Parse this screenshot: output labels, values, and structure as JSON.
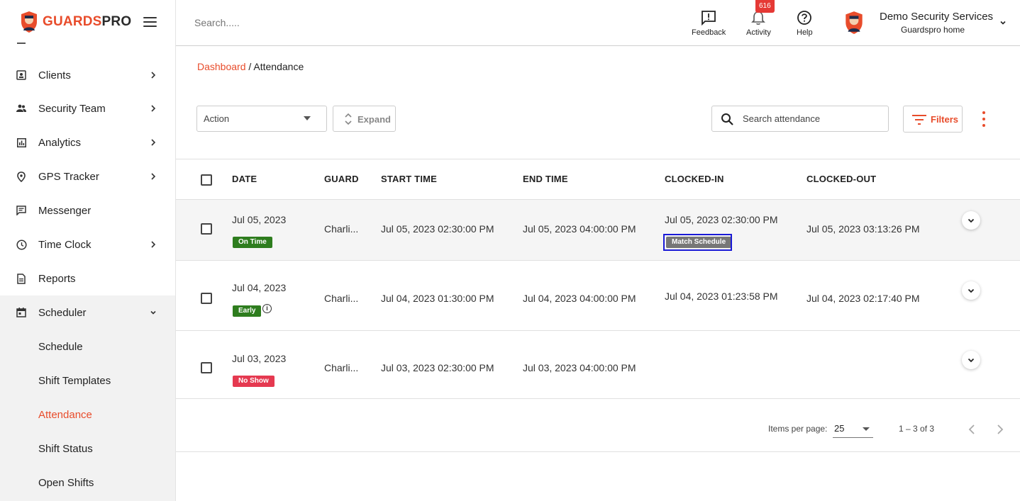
{
  "brand": {
    "part1": "GUARDS",
    "part2": "PRO"
  },
  "sidebar": {
    "items": [
      {
        "label": "Clients",
        "icon": "contact-card-icon",
        "has_chevron": true
      },
      {
        "label": "Security Team",
        "icon": "people-icon",
        "has_chevron": true
      },
      {
        "label": "Analytics",
        "icon": "bar-chart-icon",
        "has_chevron": true
      },
      {
        "label": "GPS Tracker",
        "icon": "location-pin-icon",
        "has_chevron": true
      },
      {
        "label": "Messenger",
        "icon": "message-icon",
        "has_chevron": false
      },
      {
        "label": "Time Clock",
        "icon": "clock-icon",
        "has_chevron": true
      },
      {
        "label": "Reports",
        "icon": "document-icon",
        "has_chevron": false
      },
      {
        "label": "Scheduler",
        "icon": "calendar-icon",
        "has_chevron": true,
        "expanded": true
      }
    ],
    "sub_items": [
      {
        "label": "Schedule"
      },
      {
        "label": "Shift Templates"
      },
      {
        "label": "Attendance",
        "active": true
      },
      {
        "label": "Shift Status"
      },
      {
        "label": "Open Shifts"
      }
    ]
  },
  "topbar": {
    "search_placeholder": "Search.....",
    "feedback_label": "Feedback",
    "activity_label": "Activity",
    "activity_badge": "616",
    "help_label": "Help",
    "user_name": "Demo Security Services",
    "user_sub": "Guardspro home"
  },
  "breadcrumb": {
    "root": "Dashboard",
    "separator": " / ",
    "current": "Attendance"
  },
  "toolbar": {
    "action_label": "Action",
    "expand_label": "Expand",
    "search_placeholder": "Search attendance",
    "filters_label": "Filters"
  },
  "table": {
    "columns": [
      "DATE",
      "GUARD",
      "START TIME",
      "END TIME",
      "CLOCKED-IN",
      "CLOCKED-OUT"
    ],
    "rows": [
      {
        "date": "Jul 05, 2023",
        "status": "On Time",
        "guard": "Charli...",
        "start": "Jul 05, 2023 02:30:00 PM",
        "end": "Jul 05, 2023 04:00:00 PM",
        "clocked_in": "Jul 05, 2023 02:30:00 PM",
        "clocked_in_tag": "Match Schedule",
        "clocked_out": "Jul 05, 2023 03:13:26 PM"
      },
      {
        "date": "Jul 04, 2023",
        "status": "Early",
        "guard": "Charli...",
        "start": "Jul 04, 2023 01:30:00 PM",
        "end": "Jul 04, 2023 04:00:00 PM",
        "clocked_in": "Jul 04, 2023 01:23:58 PM",
        "clocked_out": "Jul 04, 2023 02:17:40 PM"
      },
      {
        "date": "Jul 03, 2023",
        "status": "No Show",
        "guard": "Charli...",
        "start": "Jul 03, 2023 02:30:00 PM",
        "end": "Jul 03, 2023 04:00:00 PM",
        "clocked_in": "",
        "clocked_out": ""
      }
    ]
  },
  "pagination": {
    "items_per_page_label": "Items per page:",
    "items_per_page": "25",
    "range": "1 – 3 of 3"
  },
  "colors": {
    "accent": "#e84c2b",
    "on_time": "#2e7d1e",
    "no_show": "#e53950",
    "match_schedule": "#777777",
    "focus": "#1a1ad6"
  }
}
